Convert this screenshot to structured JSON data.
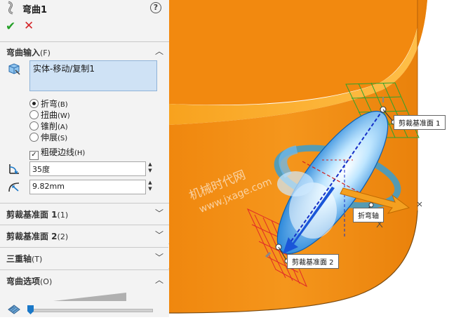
{
  "panel": {
    "title": "弯曲1",
    "help_label": "?",
    "ok_label": "✔",
    "cancel_label": "✕",
    "bend_input": {
      "header": "弯曲输入",
      "header_key": "(F)",
      "body_value": "实体-移动/复制1",
      "options": [
        {
          "label": "折弯",
          "key": "(B)",
          "selected": true
        },
        {
          "label": "扭曲",
          "key": "(W)",
          "selected": false
        },
        {
          "label": "锥削",
          "key": "(A)",
          "selected": false
        },
        {
          "label": "伸展",
          "key": "(S)",
          "selected": false
        }
      ],
      "hard_edges_label": "粗硬边线",
      "hard_edges_key": "(H)",
      "hard_edges_checked": true,
      "angle_value": "35度",
      "radius_value": "9.82mm"
    },
    "sections": [
      {
        "label": "剪裁基准面 1",
        "key": "(1)"
      },
      {
        "label": "剪裁基准面 2",
        "key": "(2)"
      },
      {
        "label": "三重轴",
        "key": "(T)"
      },
      {
        "label": "弯曲选项",
        "key": "(O)"
      }
    ],
    "accuracy_slider_fraction": 0.0
  },
  "viewport": {
    "callouts": {
      "trim_plane_1": "剪裁基准面 1",
      "trim_plane_2": "剪裁基准面 2",
      "bend_axis": "折弯轴"
    },
    "watermark_line1": "机械时代网",
    "watermark_line2": "www.jxage.com"
  },
  "colors": {
    "part_orange": "#f28a10",
    "accent_blue": "#1a78c8",
    "ok_green": "#25a028",
    "cancel_red": "#d4262a"
  }
}
